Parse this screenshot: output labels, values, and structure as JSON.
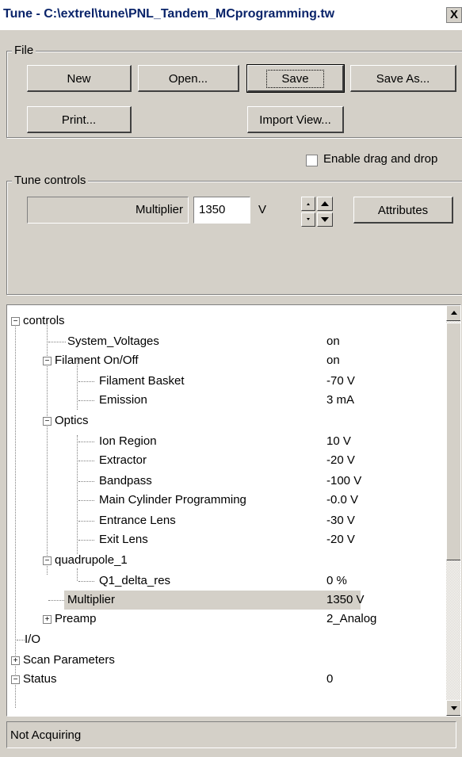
{
  "window": {
    "title": "Tune - C:\\extrel\\tune\\PNL_Tandem_MCprogramming.tw",
    "close_label": "X"
  },
  "file_group": {
    "legend": "File",
    "buttons": {
      "new": "New",
      "open": "Open...",
      "save": "Save",
      "save_as": "Save As...",
      "print": "Print...",
      "import_view": "Import View..."
    }
  },
  "enable_drag": {
    "label": "Enable drag and drop",
    "checked": false
  },
  "tune_controls": {
    "legend": "Tune controls",
    "control_name": "Multiplier",
    "value": "1350",
    "unit": "V",
    "attributes_button": "Attributes"
  },
  "tree": {
    "rows": [
      {
        "label": "controls",
        "value": ""
      },
      {
        "label": "System_Voltages",
        "value": "on"
      },
      {
        "label": "Filament On/Off",
        "value": "on"
      },
      {
        "label": "Filament Basket",
        "value": "-70 V"
      },
      {
        "label": "Emission",
        "value": "3 mA"
      },
      {
        "label": "Optics",
        "value": ""
      },
      {
        "label": "Ion Region",
        "value": "10 V"
      },
      {
        "label": "Extractor",
        "value": "-20 V"
      },
      {
        "label": "Bandpass",
        "value": "-100 V"
      },
      {
        "label": "Main Cylinder Programming",
        "value": "-0.0 V"
      },
      {
        "label": "Entrance Lens",
        "value": "-30 V"
      },
      {
        "label": "Exit Lens",
        "value": "-20 V"
      },
      {
        "label": "quadrupole_1",
        "value": ""
      },
      {
        "label": "Q1_delta_res",
        "value": "0 %"
      },
      {
        "label": "Multiplier",
        "value": "1350 V"
      },
      {
        "label": "Preamp",
        "value": "2_Analog"
      },
      {
        "label": "I/O",
        "value": ""
      },
      {
        "label": "Scan Parameters",
        "value": ""
      },
      {
        "label": "Status",
        "value": "0"
      }
    ]
  },
  "status_bar": {
    "text": "Not Acquiring"
  }
}
